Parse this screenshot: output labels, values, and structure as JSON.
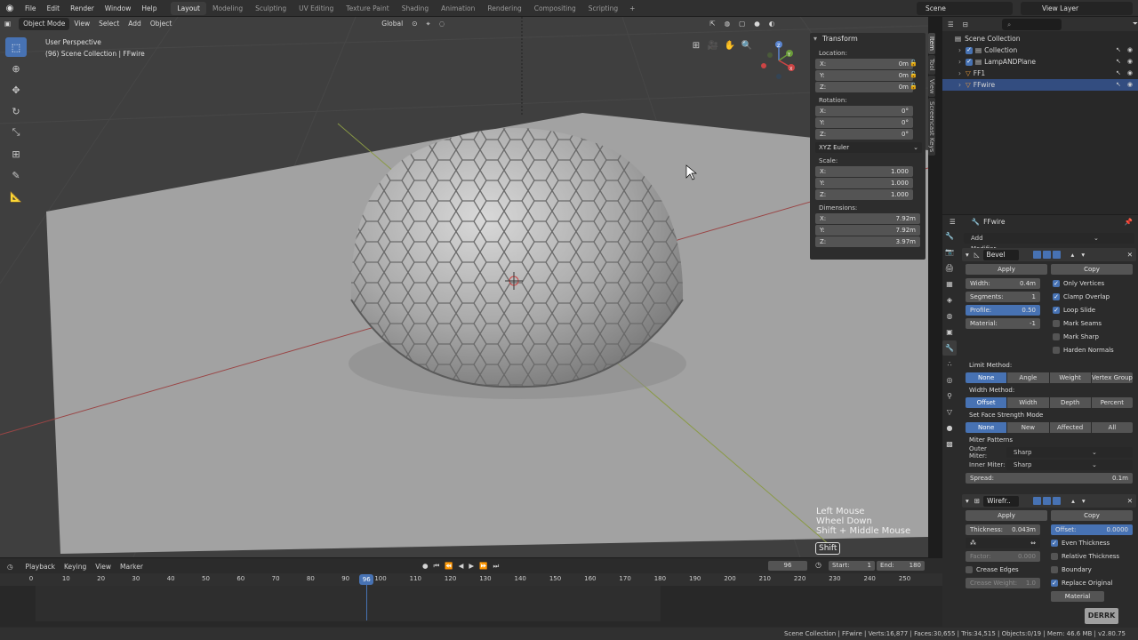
{
  "topbar": {
    "menus": [
      "File",
      "Edit",
      "Render",
      "Window",
      "Help"
    ],
    "workspaces": [
      "Layout",
      "Modeling",
      "Sculpting",
      "UV Editing",
      "Texture Paint",
      "Shading",
      "Animation",
      "Rendering",
      "Compositing",
      "Scripting"
    ],
    "active_workspace": "Layout",
    "scene": "Scene",
    "view_layer": "View Layer"
  },
  "viewport": {
    "mode": "Object Mode",
    "menus": [
      "View",
      "Select",
      "Add",
      "Object"
    ],
    "orientation": "Global",
    "info_line1": "User Perspective",
    "info_line2": "(96) Scene Collection | FFwire",
    "axis_labels": [
      "Z",
      "Y",
      "X"
    ],
    "key_overlay": [
      "Left Mouse",
      "Wheel Down",
      "Shift + Middle Mouse"
    ],
    "shift_key": "Shift"
  },
  "npanel": {
    "title": "Transform",
    "location_label": "Location:",
    "location": [
      {
        "axis": "X:",
        "value": "0m"
      },
      {
        "axis": "Y:",
        "value": "0m"
      },
      {
        "axis": "Z:",
        "value": "0m"
      }
    ],
    "rotation_label": "Rotation:",
    "rotation": [
      {
        "axis": "X:",
        "value": "0°"
      },
      {
        "axis": "Y:",
        "value": "0°"
      },
      {
        "axis": "Z:",
        "value": "0°"
      }
    ],
    "rotation_mode": "XYZ Euler",
    "scale_label": "Scale:",
    "scale": [
      {
        "axis": "X:",
        "value": "1.000"
      },
      {
        "axis": "Y:",
        "value": "1.000"
      },
      {
        "axis": "Z:",
        "value": "1.000"
      }
    ],
    "dimensions_label": "Dimensions:",
    "dimensions": [
      {
        "axis": "X:",
        "value": "7.92m"
      },
      {
        "axis": "Y:",
        "value": "7.92m"
      },
      {
        "axis": "Z:",
        "value": "3.97m"
      }
    ],
    "tabs": [
      "Item",
      "Tool",
      "View",
      "Screencast Keys"
    ]
  },
  "outliner": {
    "root": "Scene Collection",
    "rows": [
      {
        "name": "Collection"
      },
      {
        "name": "LampANDPlane"
      },
      {
        "name": "FF1"
      },
      {
        "name": "FFwire"
      }
    ]
  },
  "properties": {
    "object_name": "FFwire",
    "add_modifier": "Add Modifier",
    "bevel": {
      "name": "Bevel",
      "apply": "Apply",
      "copy": "Copy",
      "fields": [
        {
          "label": "Width:",
          "value": "0.4m"
        },
        {
          "label": "Segments:",
          "value": "1"
        },
        {
          "label": "Profile:",
          "value": "0.50"
        },
        {
          "label": "Material:",
          "value": "-1"
        }
      ],
      "checks": [
        {
          "label": "Only Vertices",
          "on": true
        },
        {
          "label": "Clamp Overlap",
          "on": true
        },
        {
          "label": "Loop Slide",
          "on": true
        },
        {
          "label": "Mark Seams",
          "on": false
        },
        {
          "label": "Mark Sharp",
          "on": false
        },
        {
          "label": "Harden Normals",
          "on": false
        }
      ],
      "limit_method_label": "Limit Method:",
      "limit_method": [
        "None",
        "Angle",
        "Weight",
        "Vertex Group"
      ],
      "width_method_label": "Width Method:",
      "width_method": [
        "Offset",
        "Width",
        "Depth",
        "Percent"
      ],
      "face_strength_label": "Set Face Strength Mode",
      "face_strength": [
        "None",
        "New",
        "Affected",
        "All"
      ],
      "miter_label": "Miter Patterns",
      "outer_miter_label": "Outer Miter:",
      "outer_miter": "Sharp",
      "inner_miter_label": "Inner Miter:",
      "inner_miter": "Sharp",
      "spread_label": "Spread:",
      "spread": "0.1m"
    },
    "wire": {
      "name": "Wirefr..",
      "apply": "Apply",
      "copy": "Copy",
      "thickness_label": "Thickness:",
      "thickness": "0.043m",
      "offset_label": "Offset:",
      "offset": "0.0000",
      "factor_label": "Factor:",
      "factor": "0.000",
      "crease_weight_label": "Crease Weight:",
      "crease_weight": "1.0",
      "checks": [
        {
          "label": "Even Thickness",
          "on": true
        },
        {
          "label": "Relative Thickness",
          "on": false
        },
        {
          "label": "Boundary",
          "on": false
        },
        {
          "label": "Replace Original",
          "on": true
        }
      ],
      "crease_edges": "Crease Edges",
      "material": "Material"
    }
  },
  "timeline": {
    "menus": [
      "Playback",
      "Keying",
      "View",
      "Marker"
    ],
    "current_frame": "96",
    "start_label": "Start:",
    "start": "1",
    "end_label": "End:",
    "end": "180",
    "ticks": [
      "0",
      "10",
      "20",
      "30",
      "40",
      "50",
      "60",
      "70",
      "80",
      "90",
      "100",
      "110",
      "120",
      "130",
      "140",
      "150",
      "160",
      "170",
      "180",
      "190",
      "200",
      "210",
      "220",
      "230",
      "240",
      "250"
    ],
    "playhead": "96"
  },
  "statusbar": "Scene Collection | FFwire | Verts:16,877 | Faces:30,655 | Tris:34,515 | Objects:0/19 | Mem: 46.6 MB | v2.80.75",
  "watermark": "DERRK",
  "colors": {
    "accent": "#4772b3",
    "viewport": "#3e3e3e",
    "panel": "#2b2b2b"
  }
}
